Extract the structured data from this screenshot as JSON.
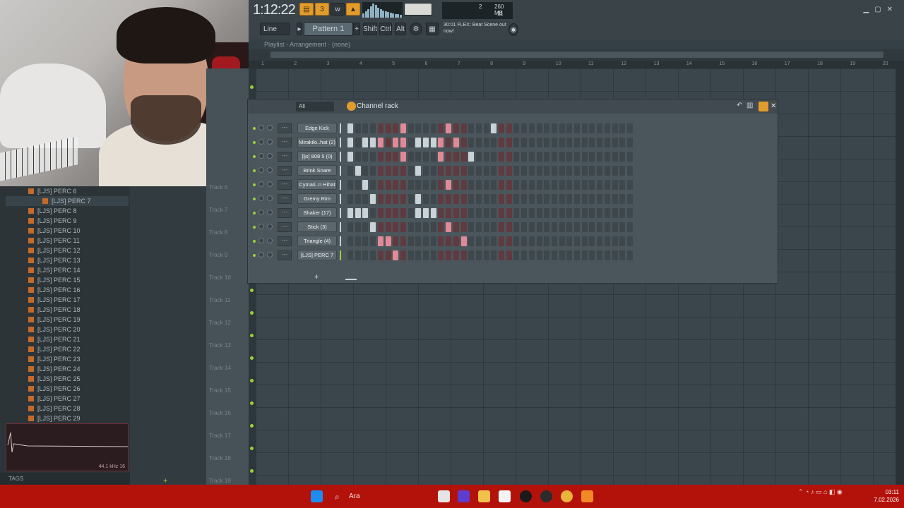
{
  "title_bar": {
    "time": "1:12:22",
    "pattern_label": "Pattern 1",
    "mode_label": "Line",
    "shift_label": "Shift",
    "ctrl_label": "Ctrl",
    "alt_label": "Alt",
    "cpu_voices": "2",
    "ram": "260 MB",
    "polyphony": "11",
    "news_text": "30:01  FLEX: Beat Scene out now!"
  },
  "playlist": {
    "title": "Playlist - Arrangement",
    "arrangement": "(none)",
    "bar_numbers": [
      "1",
      "2",
      "3",
      "4",
      "5",
      "6",
      "7",
      "8",
      "9",
      "10",
      "11",
      "12",
      "13",
      "14",
      "15",
      "16",
      "17",
      "18",
      "19",
      "20"
    ],
    "tracks": [
      "Track 6",
      "Track 7",
      "Track 8",
      "Track 9",
      "Track 10",
      "Track 11",
      "Track 12",
      "Track 13",
      "Track 14",
      "Track 15",
      "Track 16",
      "Track 17",
      "Track 18",
      "Track 19"
    ]
  },
  "browser": {
    "selected": "[LJS] PERC 7",
    "items": [
      "[LJS] PERC 6",
      "[LJS] PERC 7",
      "[LJS] PERC 8",
      "[LJS] PERC 9",
      "[LJS] PERC 10",
      "[LJS] PERC 11",
      "[LJS] PERC 12",
      "[LJS] PERC 13",
      "[LJS] PERC 14",
      "[LJS] PERC 15",
      "[LJS] PERC 16",
      "[LJS] PERC 17",
      "[LJS] PERC 18",
      "[LJS] PERC 19",
      "[LJS] PERC 20",
      "[LJS] PERC 21",
      "[LJS] PERC 22",
      "[LJS] PERC 23",
      "[LJS] PERC 24",
      "[LJS] PERC 25",
      "[LJS] PERC 26",
      "[LJS] PERC 27",
      "[LJS] PERC 28",
      "[LJS] PERC 29"
    ],
    "sample_info": "44.1 kHz 16",
    "tags_label": "TAGS"
  },
  "channel_rack": {
    "title": "Channel rack",
    "filter": "All",
    "channels": [
      {
        "name": "Edge Kick",
        "steps": [
          1,
          0,
          0,
          0,
          0,
          0,
          0,
          1,
          0,
          0,
          0,
          0,
          0,
          1,
          0,
          0,
          0,
          0,
          0,
          1,
          0,
          0
        ]
      },
      {
        "name": "Mirakilo..hat (2)",
        "steps": [
          1,
          0,
          1,
          1,
          1,
          0,
          1,
          1,
          0,
          1,
          1,
          1,
          1,
          0,
          1,
          0,
          0,
          0,
          0,
          0,
          0,
          0
        ]
      },
      {
        "name": "[ljs] 808 5 (0)",
        "steps": [
          1,
          0,
          0,
          0,
          0,
          0,
          0,
          1,
          0,
          0,
          0,
          0,
          1,
          0,
          0,
          0,
          1,
          0,
          0,
          0,
          0,
          0
        ]
      },
      {
        "name": "Brink Snare",
        "steps": [
          0,
          1,
          0,
          0,
          0,
          0,
          0,
          0,
          0,
          1,
          0,
          0,
          0,
          0,
          0,
          0,
          0,
          0,
          0,
          0,
          0,
          0
        ]
      },
      {
        "name": "Cymati..n Hihat",
        "steps": [
          0,
          0,
          1,
          0,
          0,
          0,
          0,
          0,
          0,
          0,
          0,
          0,
          0,
          1,
          0,
          0,
          0,
          0,
          0,
          0,
          0,
          0
        ]
      },
      {
        "name": "Gremy Rim",
        "steps": [
          0,
          0,
          0,
          1,
          0,
          0,
          0,
          0,
          0,
          1,
          0,
          0,
          0,
          0,
          0,
          0,
          0,
          0,
          0,
          0,
          0,
          0
        ]
      },
      {
        "name": "Shaker (17)",
        "steps": [
          1,
          1,
          1,
          0,
          0,
          0,
          0,
          0,
          0,
          1,
          1,
          1,
          0,
          0,
          0,
          0,
          0,
          0,
          0,
          0,
          0,
          0
        ]
      },
      {
        "name": "Stick (3)",
        "steps": [
          0,
          0,
          0,
          1,
          0,
          0,
          0,
          0,
          0,
          0,
          0,
          0,
          0,
          1,
          0,
          0,
          0,
          0,
          0,
          0,
          0,
          0
        ]
      },
      {
        "name": "Triangle (4)",
        "steps": [
          0,
          0,
          0,
          0,
          1,
          1,
          0,
          0,
          0,
          0,
          0,
          0,
          0,
          0,
          0,
          1,
          0,
          0,
          0,
          0,
          0,
          0
        ]
      },
      {
        "name": "[LJS] PERC 7",
        "steps": [
          0,
          0,
          0,
          0,
          0,
          0,
          1,
          0,
          0,
          0,
          0,
          0,
          0,
          0,
          0,
          0,
          0,
          0,
          0,
          0,
          0,
          0
        ]
      }
    ]
  },
  "taskbar": {
    "search_placeholder": "Ara",
    "time": "03:11",
    "date": "7.02.2026"
  }
}
